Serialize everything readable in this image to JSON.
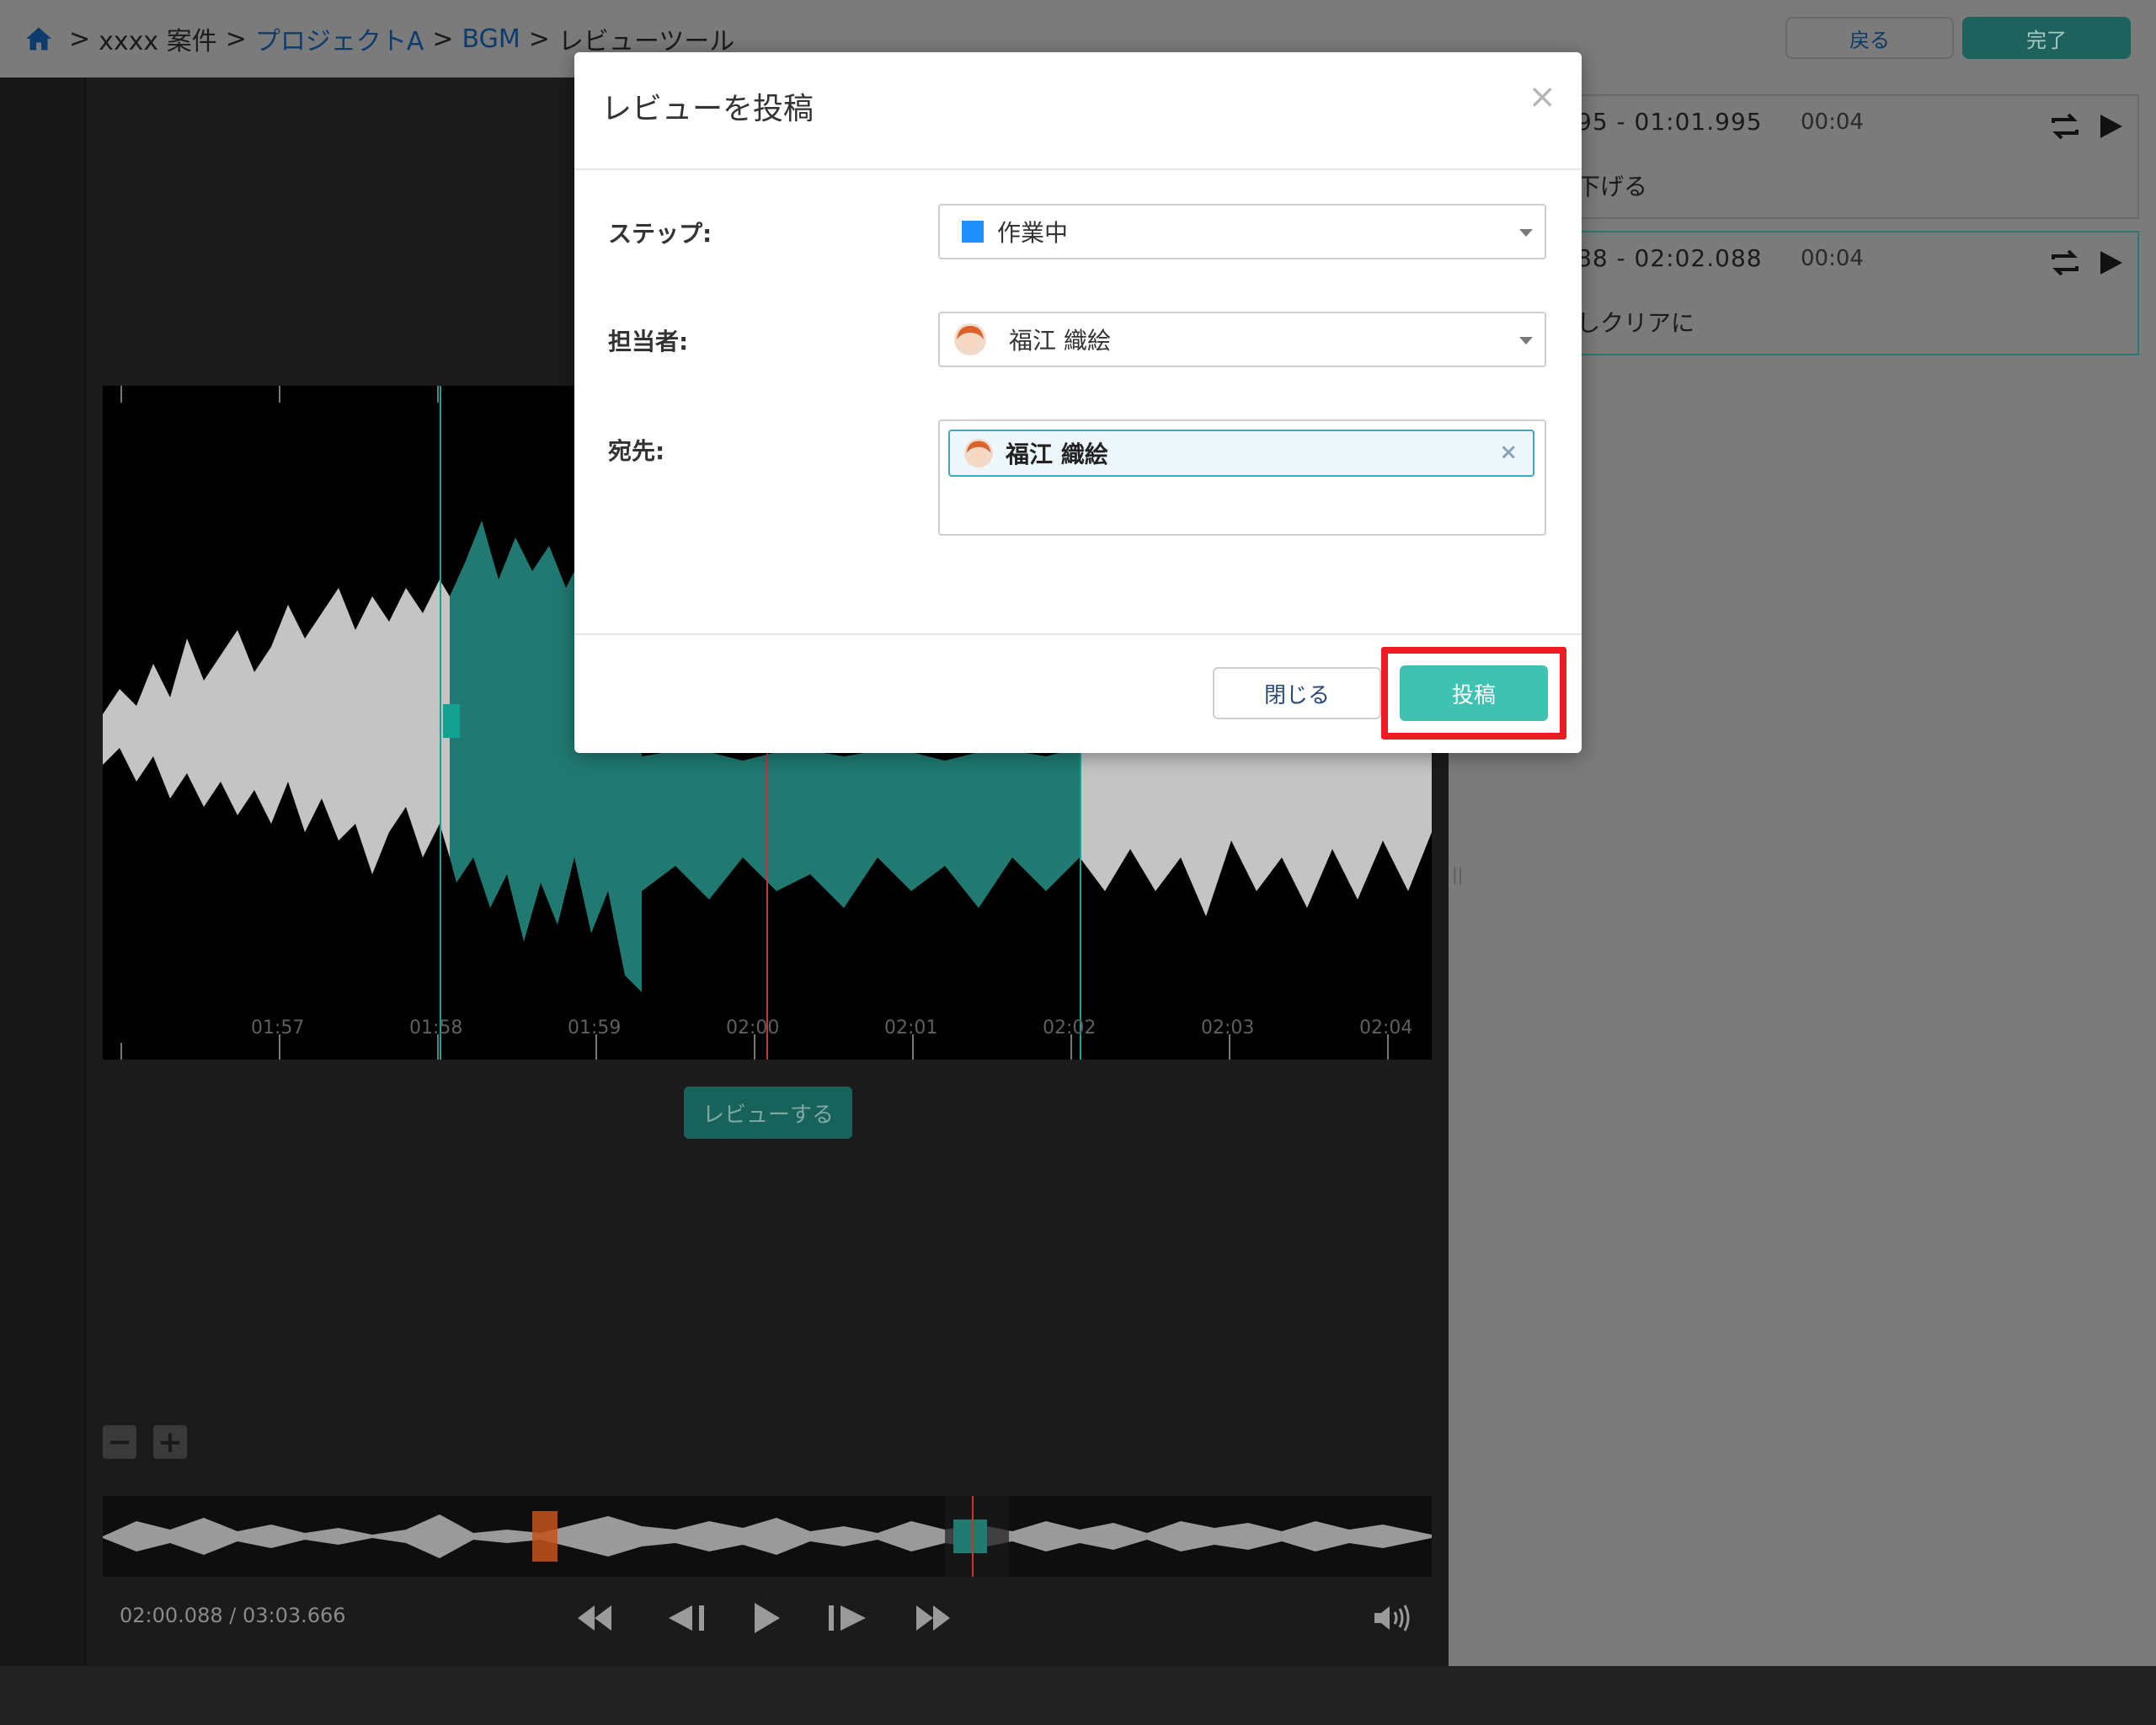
{
  "breadcrumb": {
    "sep": ">",
    "project_client": "xxxx 案件",
    "project": "プロジェクトA",
    "folder": "BGM",
    "current": "レビューツール"
  },
  "header": {
    "back_label": "戻る",
    "done_label": "完了"
  },
  "waveform": {
    "ticks": [
      "01:57",
      "01:58",
      "01:59",
      "02:00",
      "02:01",
      "02:02",
      "02:03",
      "02:04"
    ],
    "colors": {
      "played": "#bdbdbd",
      "selected": "#207a72",
      "background": "#000000",
      "playhead": "#c0392b"
    }
  },
  "review_button_label": "レビューする",
  "zoom": {
    "minus": "−",
    "plus": "+"
  },
  "player": {
    "timecode": "02:00.088 / 03:03.666"
  },
  "comments": [
    {
      "range": "95 - 01:01.995",
      "duration": "00:04",
      "text": "下げる"
    },
    {
      "range": "88 - 02:02.088",
      "duration": "00:04",
      "text": "しクリアに"
    }
  ],
  "split_handle": "||",
  "modal": {
    "title": "レビューを投稿",
    "close": "×",
    "step_label": "ステップ:",
    "step_value": "作業中",
    "step_color": "#1e90ff",
    "assignee_label": "担当者:",
    "assignee_value": "福江 織絵",
    "to_label": "宛先:",
    "to_chip": "福江 織絵",
    "chip_remove": "×",
    "close_button": "閉じる",
    "post_button": "投稿"
  }
}
